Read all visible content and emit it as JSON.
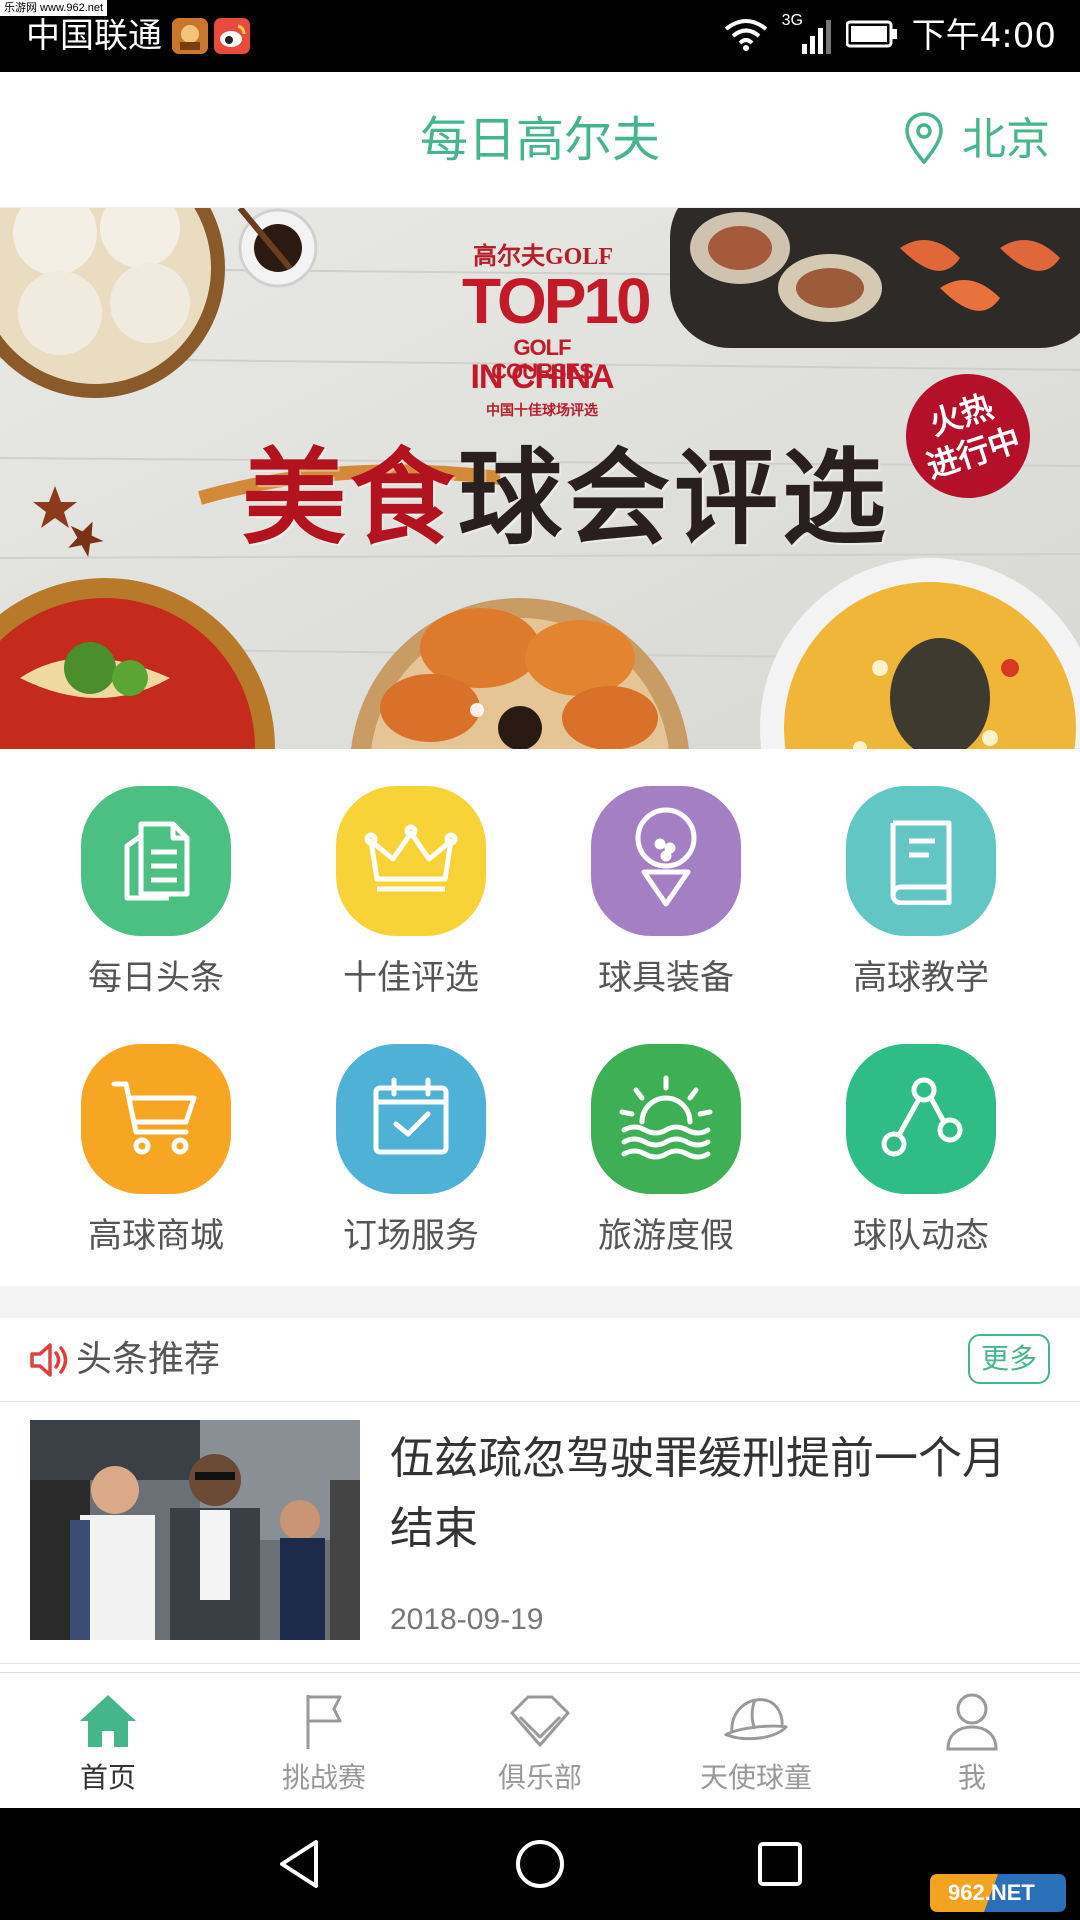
{
  "status_bar": {
    "watermark": "乐游网 www.962.net",
    "carrier": "中国联通",
    "network": "3G",
    "time": "下午4:00"
  },
  "header": {
    "title": "每日高尔夫",
    "location": "北京"
  },
  "banner": {
    "brand_line": "高尔夫GOLF",
    "top_line": "TOP10",
    "golf_line": "GOLF COURSES",
    "china_line": "IN CHINA",
    "sub_line": "中国十佳球场评选",
    "main_part1": "美食",
    "main_part2": "球会评选",
    "badge_line1": "火热",
    "badge_line2": "进行中",
    "slide_count": 1,
    "active_slide": 1
  },
  "grid": {
    "items": [
      {
        "label": "每日头条",
        "color": "#4cbf83",
        "icon": "document-icon"
      },
      {
        "label": "十佳评选",
        "color": "#f7d338",
        "icon": "crown-icon"
      },
      {
        "label": "球具装备",
        "color": "#a57fc3",
        "icon": "golf-ball-tee-icon"
      },
      {
        "label": "高球教学",
        "color": "#62c7c4",
        "icon": "book-icon"
      },
      {
        "label": "高球商城",
        "color": "#f6a623",
        "icon": "cart-icon"
      },
      {
        "label": "订场服务",
        "color": "#4fb1d6",
        "icon": "calendar-check-icon"
      },
      {
        "label": "旅游度假",
        "color": "#3faf55",
        "icon": "sunrise-icon"
      },
      {
        "label": "球队动态",
        "color": "#2fbc86",
        "icon": "share-nodes-icon"
      }
    ]
  },
  "headlines": {
    "title": "头条推荐",
    "more": "更多",
    "articles": [
      {
        "title": "伍兹疏忽驾驶罪缓刑提前一个月结束",
        "date": "2018-09-19"
      }
    ]
  },
  "tabs": [
    {
      "label": "首页",
      "icon": "home-icon",
      "active": true
    },
    {
      "label": "挑战赛",
      "icon": "flag-icon",
      "active": false
    },
    {
      "label": "俱乐部",
      "icon": "diamond-icon",
      "active": false
    },
    {
      "label": "天使球童",
      "icon": "cap-icon",
      "active": false
    },
    {
      "label": "我",
      "icon": "person-icon",
      "active": false
    }
  ],
  "colors": {
    "accent": "#45b58c",
    "inactive_tab": "#999999",
    "speaker": "#e0403a"
  }
}
